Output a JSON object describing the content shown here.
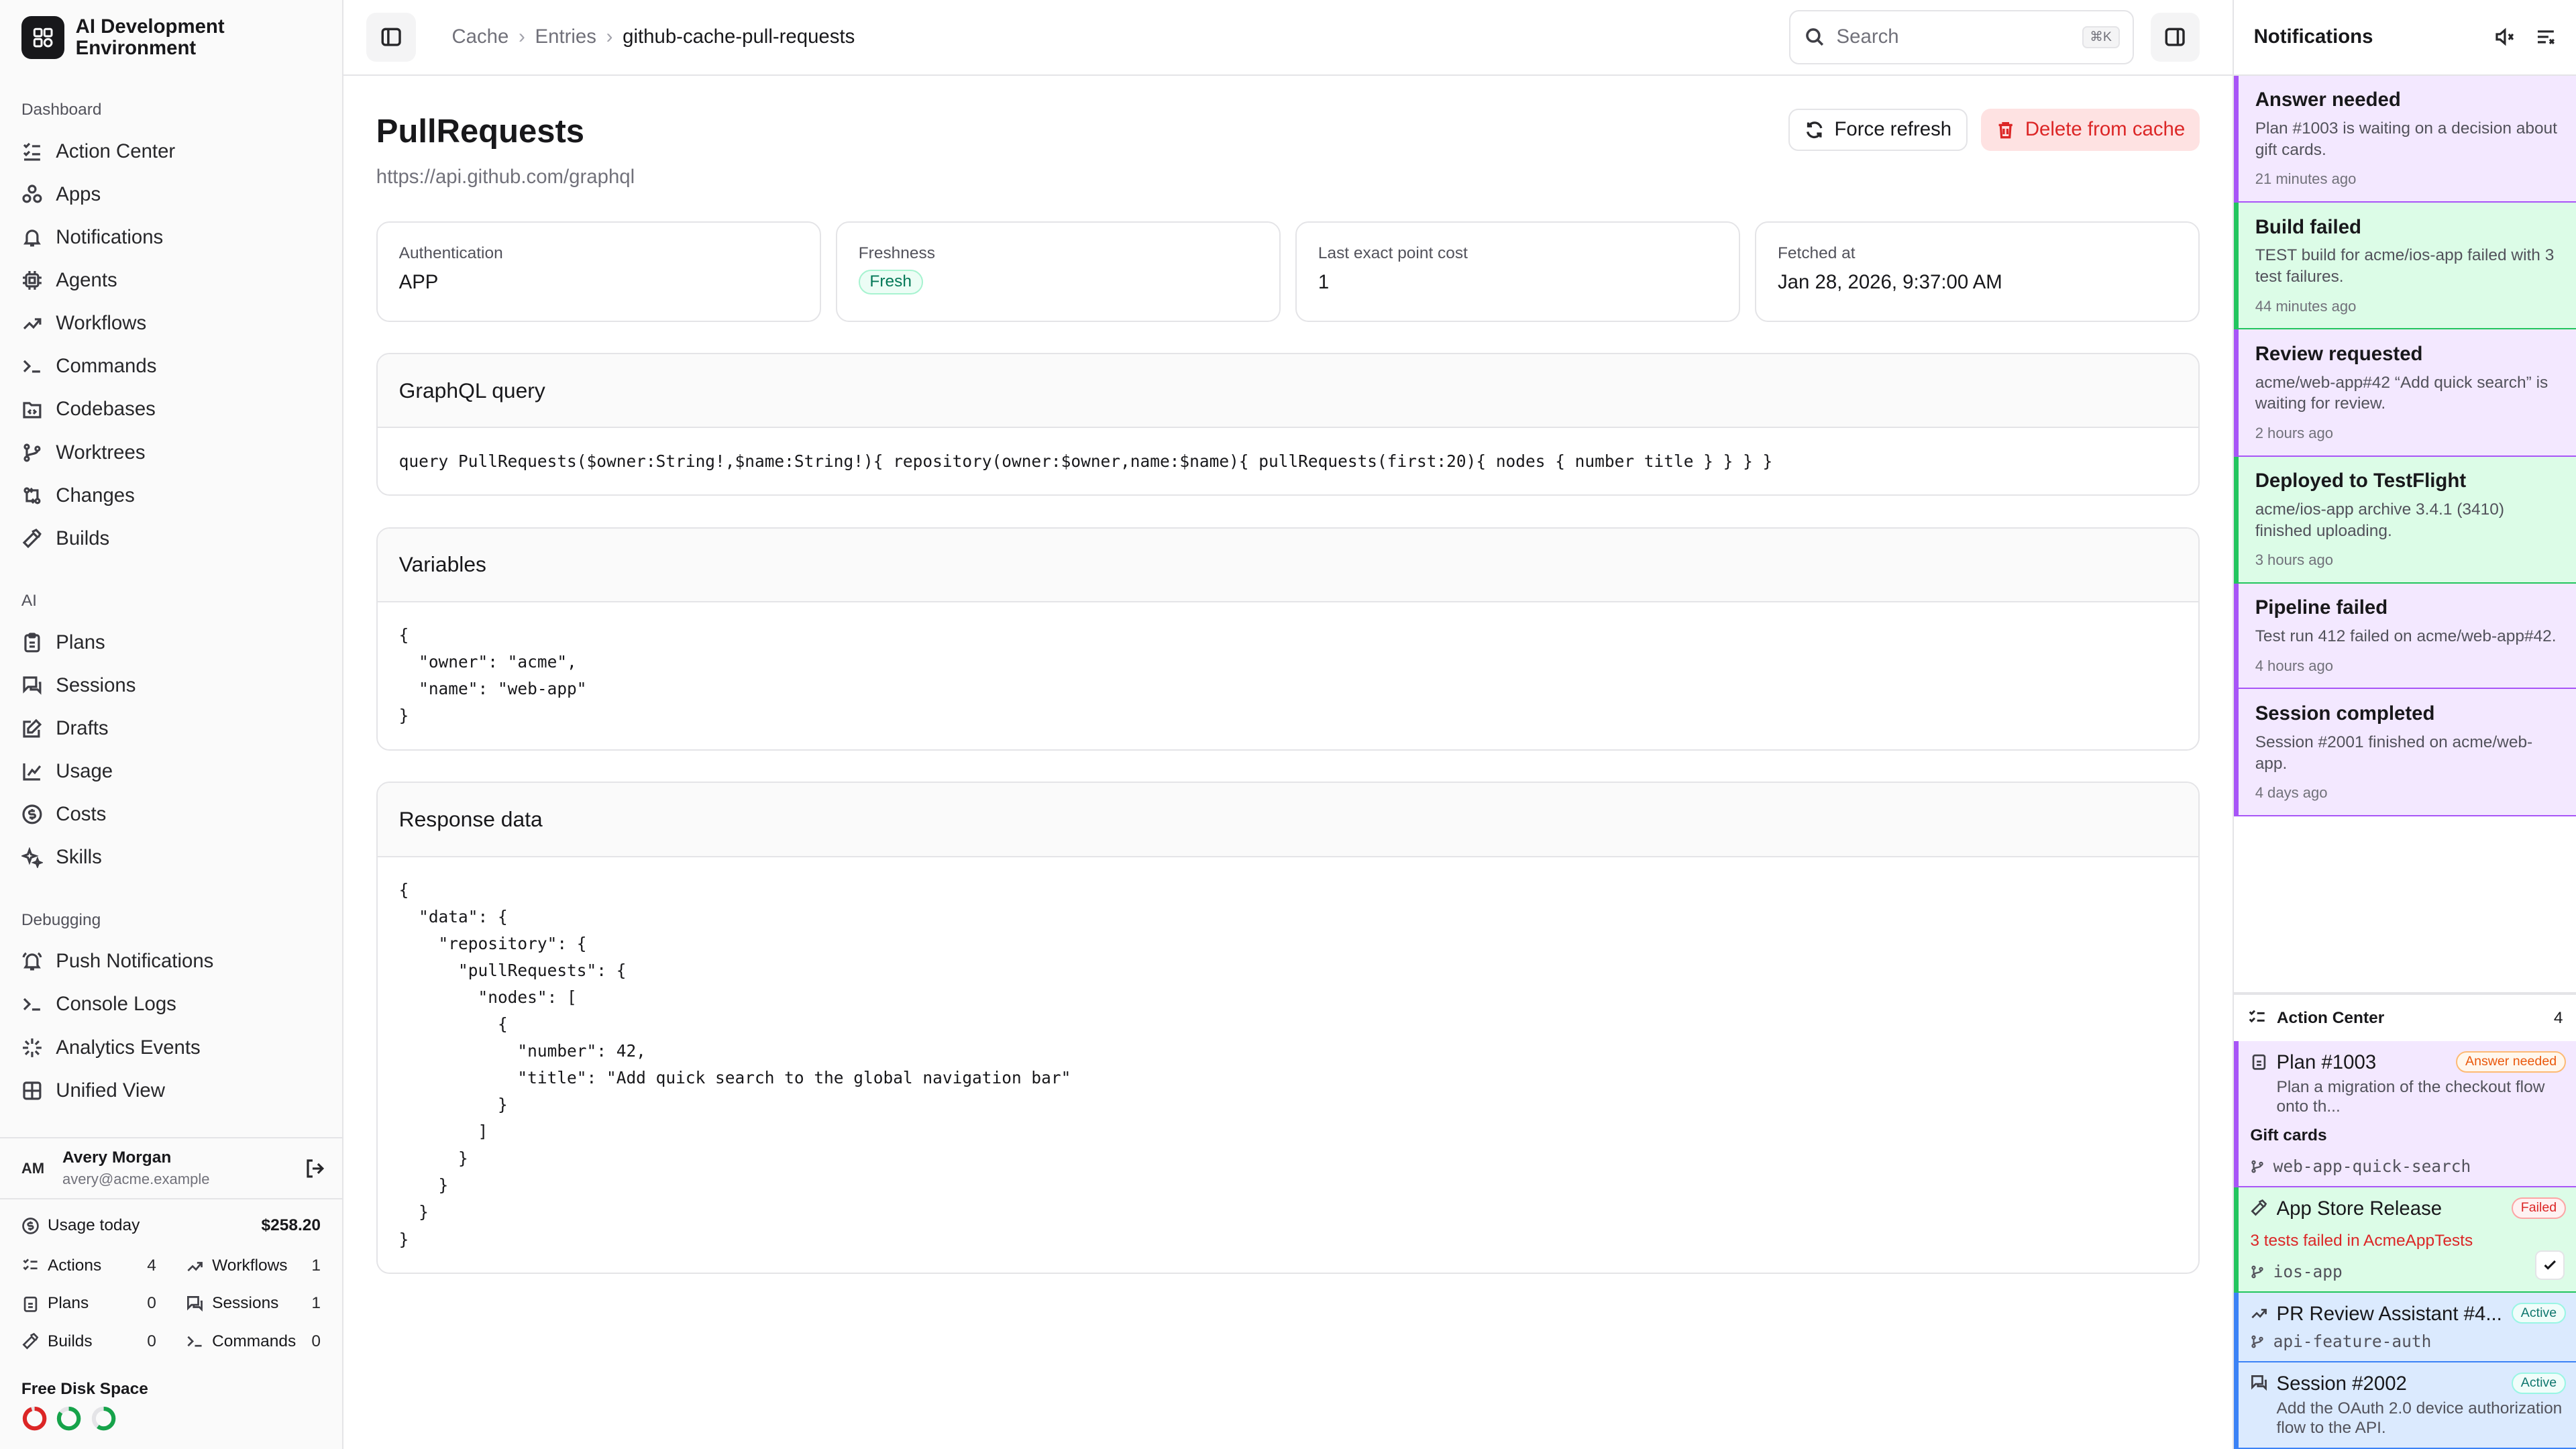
{
  "app": {
    "name": "AI Development Environment"
  },
  "sidebar": {
    "groups": [
      {
        "label": "Dashboard",
        "items": [
          "Action Center",
          "Apps",
          "Notifications",
          "Agents",
          "Workflows",
          "Commands",
          "Codebases",
          "Worktrees",
          "Changes",
          "Builds"
        ]
      },
      {
        "label": "AI",
        "items": [
          "Plans",
          "Sessions",
          "Drafts",
          "Usage",
          "Costs",
          "Skills"
        ]
      },
      {
        "label": "Debugging",
        "items": [
          "Push Notifications",
          "Console Logs",
          "Analytics Events",
          "Unified View"
        ]
      }
    ],
    "user": {
      "initials": "AM",
      "name": "Avery Morgan",
      "email": "avery@acme.example"
    },
    "usage": {
      "label": "Usage today",
      "amount": "$258.20",
      "stats": [
        {
          "label": "Actions",
          "value": "4"
        },
        {
          "label": "Workflows",
          "value": "1"
        },
        {
          "label": "Plans",
          "value": "0"
        },
        {
          "label": "Sessions",
          "value": "1"
        },
        {
          "label": "Builds",
          "value": "0"
        },
        {
          "label": "Commands",
          "value": "0"
        }
      ]
    },
    "disk": {
      "label": "Free Disk Space",
      "rings": [
        {
          "fraction": 0.95,
          "color": "#dc2626"
        },
        {
          "fraction": 0.85,
          "color": "#16a34a"
        },
        {
          "fraction": 0.6,
          "color": "#16a34a"
        }
      ]
    }
  },
  "topbar": {
    "breadcrumbs": [
      "Cache",
      "Entries",
      "github-cache-pull-requests"
    ],
    "search_placeholder": "Search",
    "search_shortcut": "⌘K"
  },
  "page": {
    "title": "PullRequests",
    "url": "https://api.github.com/graphql",
    "force_refresh": "Force refresh",
    "delete": "Delete from cache",
    "meta": {
      "auth_label": "Authentication",
      "auth_value": "APP",
      "fresh_label": "Freshness",
      "fresh_value": "Fresh",
      "cost_label": "Last exact point cost",
      "cost_value": "1",
      "fetched_label": "Fetched at",
      "fetched_value": "Jan 28, 2026, 9:37:00 AM"
    },
    "query_title": "GraphQL query",
    "query": "query PullRequests($owner:String!,$name:String!){ repository(owner:$owner,name:$name){ pullRequests(first:20){ nodes { number title } } } }",
    "variables_title": "Variables",
    "variables": "{\n  \"owner\": \"acme\",\n  \"name\": \"web-app\"\n}",
    "response_title": "Response data",
    "response": "{\n  \"data\": {\n    \"repository\": {\n      \"pullRequests\": {\n        \"nodes\": [\n          {\n            \"number\": 42,\n            \"title\": \"Add quick search to the global navigation bar\"\n          }\n        ]\n      }\n    }\n  }\n}"
  },
  "notifications": {
    "title": "Notifications",
    "items": [
      {
        "title": "Answer needed",
        "body": "Plan #1003 is waiting on a decision about gift cards.",
        "time": "21 minutes ago",
        "color": "#a855f7",
        "bg": "#f3e8ff"
      },
      {
        "title": "Build failed",
        "body": "TEST build for acme/ios-app failed with 3 test failures.",
        "time": "44 minutes ago",
        "color": "#22c55e",
        "bg": "#dcfce7"
      },
      {
        "title": "Review requested",
        "body": "acme/web-app#42 “Add quick search” is waiting for review.",
        "time": "2 hours ago",
        "color": "#a855f7",
        "bg": "#f3e8ff"
      },
      {
        "title": "Deployed to TestFlight",
        "body": "acme/ios-app archive 3.4.1 (3410) finished uploading.",
        "time": "3 hours ago",
        "color": "#22c55e",
        "bg": "#dcfce7"
      },
      {
        "title": "Pipeline failed",
        "body": "Test run 412 failed on acme/web-app#42.",
        "time": "4 hours ago",
        "color": "#a855f7",
        "bg": "#f3e8ff"
      },
      {
        "title": "Session completed",
        "body": "Session #2001 finished on acme/web-app.",
        "time": "4 days ago",
        "color": "#a855f7",
        "bg": "#f3e8ff"
      }
    ]
  },
  "action_center": {
    "title": "Action Center",
    "count": "4",
    "items": [
      {
        "title": "Plan #1003",
        "tag": "Answer needed",
        "desc": "Plan a migration of the checkout flow onto th...",
        "sub": "Gift cards",
        "branch": "web-app-quick-search"
      },
      {
        "title": "App Store Release",
        "tag": "Failed",
        "error": "3 tests failed in AcmeAppTests",
        "branch": "ios-app"
      },
      {
        "title": "PR Review Assistant #4...",
        "tag": "Active",
        "branch": "api-feature-auth"
      },
      {
        "title": "Session #2002",
        "tag": "Active",
        "desc": "Add the OAuth 2.0 device authorization flow to the API."
      }
    ]
  }
}
